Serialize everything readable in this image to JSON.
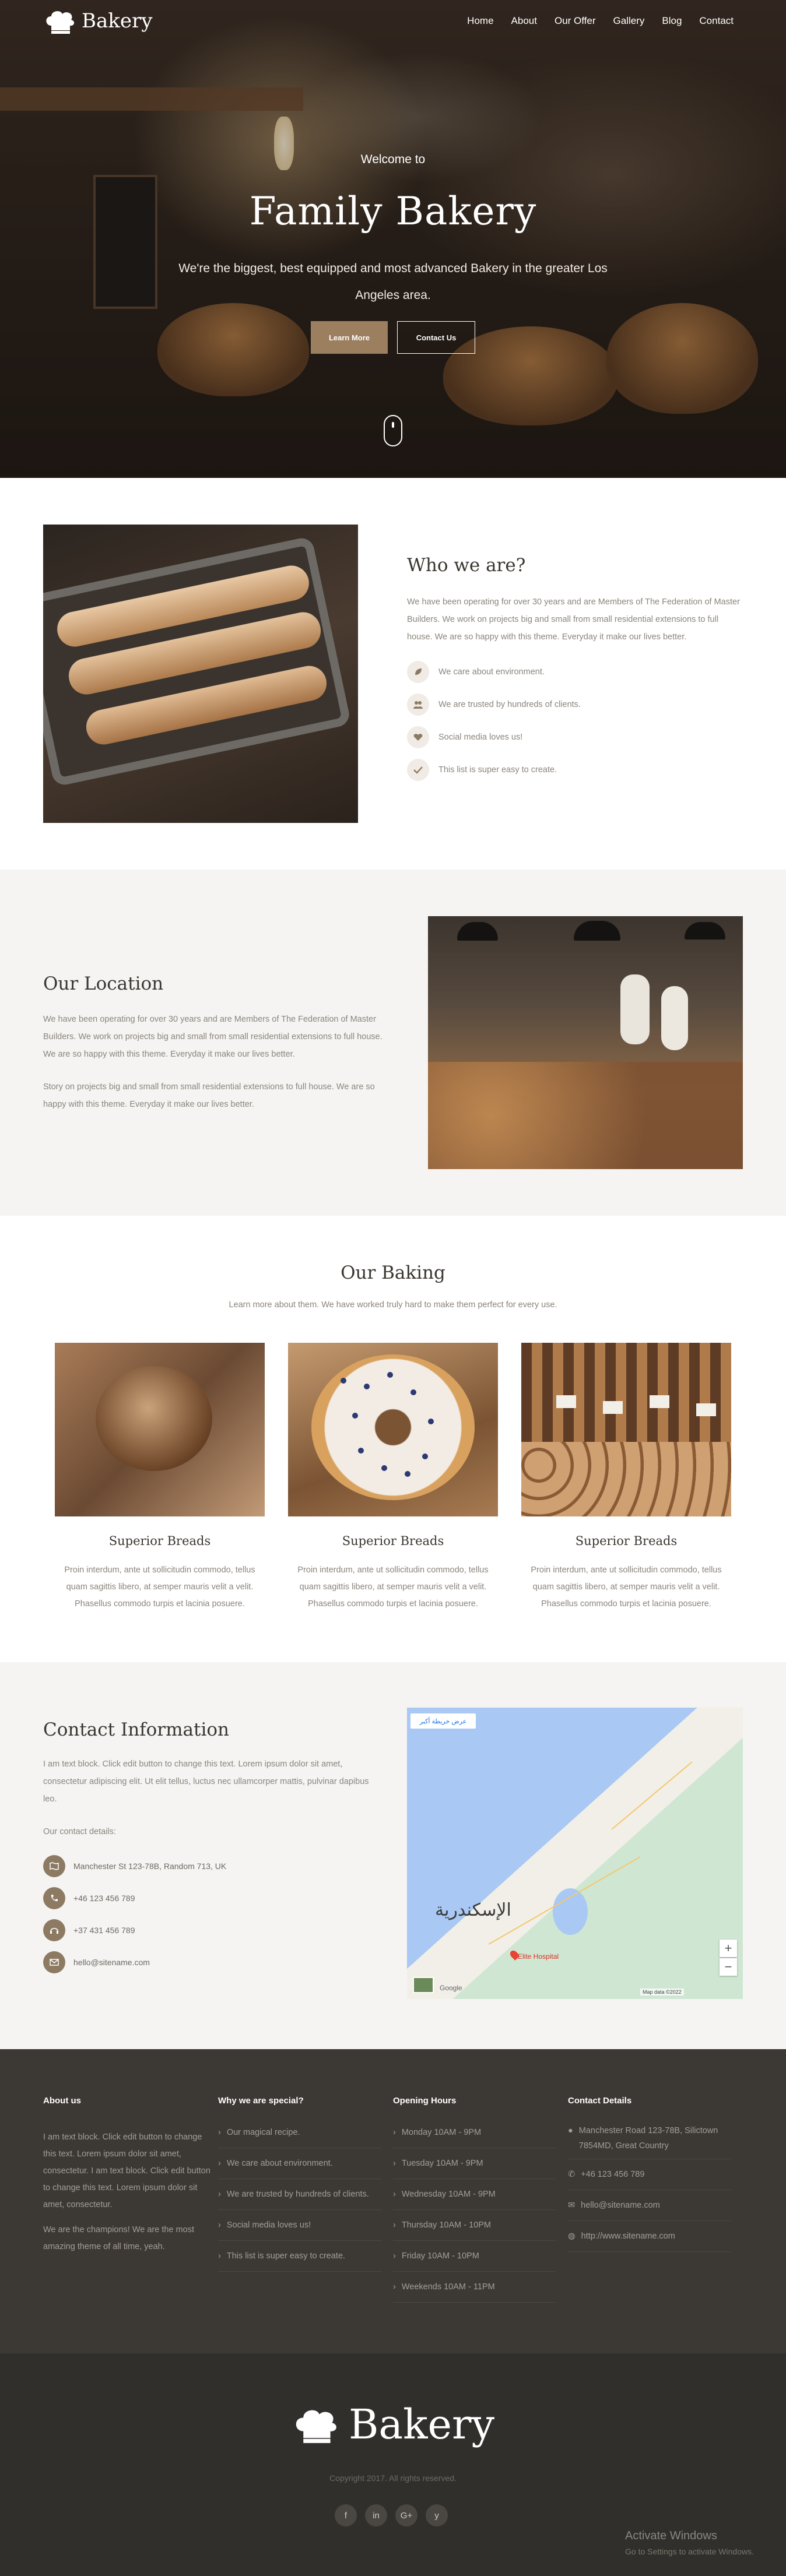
{
  "nav": {
    "logo": "Bakery",
    "items": [
      "Home",
      "About",
      "Our Offer",
      "Gallery",
      "Blog",
      "Contact"
    ]
  },
  "hero": {
    "pretitle": "Welcome to",
    "title": "Family Bakery",
    "text": "We're the biggest, best equipped and most advanced Bakery in the greater Los Angeles area.",
    "btn_learn": "Learn More",
    "btn_contact": "Contact Us"
  },
  "about": {
    "title": "Who we are?",
    "text": "We have been operating for over 30 years and are Members of The Federation of Master Builders. We work on projects big and small from small residential extensions to full house. We are so happy with this theme. Everyday it make our lives better.",
    "items": [
      "We care about environment.",
      "We are trusted by hundreds of clients.",
      "Social media loves us!",
      "This list is super easy to create."
    ]
  },
  "location": {
    "title": "Our Location",
    "p1": "We have been operating for over 30 years and are Members of The Federation of Master Builders. We work on projects big and small from small residential extensions to full house. We are so happy with this theme. Everyday it make our lives better.",
    "p2": "Story on projects big and small from small residential extensions to full house. We are so happy with this theme. Everyday it make our lives better."
  },
  "baking": {
    "title": "Our Baking",
    "subtitle": "Learn more about them. We have worked truly hard to make them perfect for every use.",
    "cards": [
      {
        "title": "Superior Breads",
        "text": "Proin interdum, ante ut sollicitudin commodo, tellus quam sagittis libero, at semper mauris velit a velit. Phasellus commodo turpis et lacinia posuere."
      },
      {
        "title": "Superior Breads",
        "text": "Proin interdum, ante ut sollicitudin commodo, tellus quam sagittis libero, at semper mauris velit a velit. Phasellus commodo turpis et lacinia posuere."
      },
      {
        "title": "Superior Breads",
        "text": "Proin interdum, ante ut sollicitudin commodo, tellus quam sagittis libero, at semper mauris velit a velit. Phasellus commodo turpis et lacinia posuere."
      }
    ]
  },
  "contact": {
    "title": "Contact Information",
    "text": "I am text block. Click edit button to change this text. Lorem ipsum dolor sit amet, consectetur adipiscing elit. Ut elit tellus, luctus nec ullamcorper mattis, pulvinar dapibus leo.",
    "details_label": "Our contact details:",
    "items": [
      "Manchester St 123-78B, Random 713, UK",
      "+46 123 456 789",
      "+37 431 456 789",
      "hello@sitename.com"
    ]
  },
  "map": {
    "city": "الإسكندرية",
    "tag": "عرض خريطة أكبر",
    "poi": "Elite Hospital",
    "google": "Google",
    "terms": "Map data ©2022"
  },
  "footer": {
    "about_title": "About us",
    "about_p1": "I am text block. Click edit button to change this text. Lorem ipsum dolor sit amet, consectetur. I am text block. Click edit button to change this text. Lorem ipsum dolor sit amet, consectetur.",
    "about_p2": "We are the champions! We are the most amazing theme of all time, yeah.",
    "special_title": "Why we are special?",
    "special": [
      "Our magical recipe.",
      "We care about environment.",
      "We are trusted by hundreds of clients.",
      "Social media loves us!",
      "This list is super easy to create."
    ],
    "hours_title": "Opening Hours",
    "hours": [
      "Monday 10AM - 9PM",
      "Tuesday 10AM - 9PM",
      "Wednesday 10AM - 9PM",
      "Thursday 10AM - 10PM",
      "Friday 10AM - 10PM",
      "Weekends 10AM - 11PM"
    ],
    "details_title": "Contact Details",
    "address": "Manchester Road 123-78B, Silictown 7854MD, Great Country",
    "phone": "+46 123 456 789",
    "email": "hello@sitename.com",
    "web": "http://www.sitename.com"
  },
  "bottom": {
    "logo": "Bakery",
    "copyright": "Copyright 2017. All rights reserved.",
    "social": [
      "f",
      "in",
      "G+",
      "y"
    ]
  },
  "watermark": {
    "line1": "Activate Windows",
    "line2": "Go to Settings to activate Windows."
  }
}
